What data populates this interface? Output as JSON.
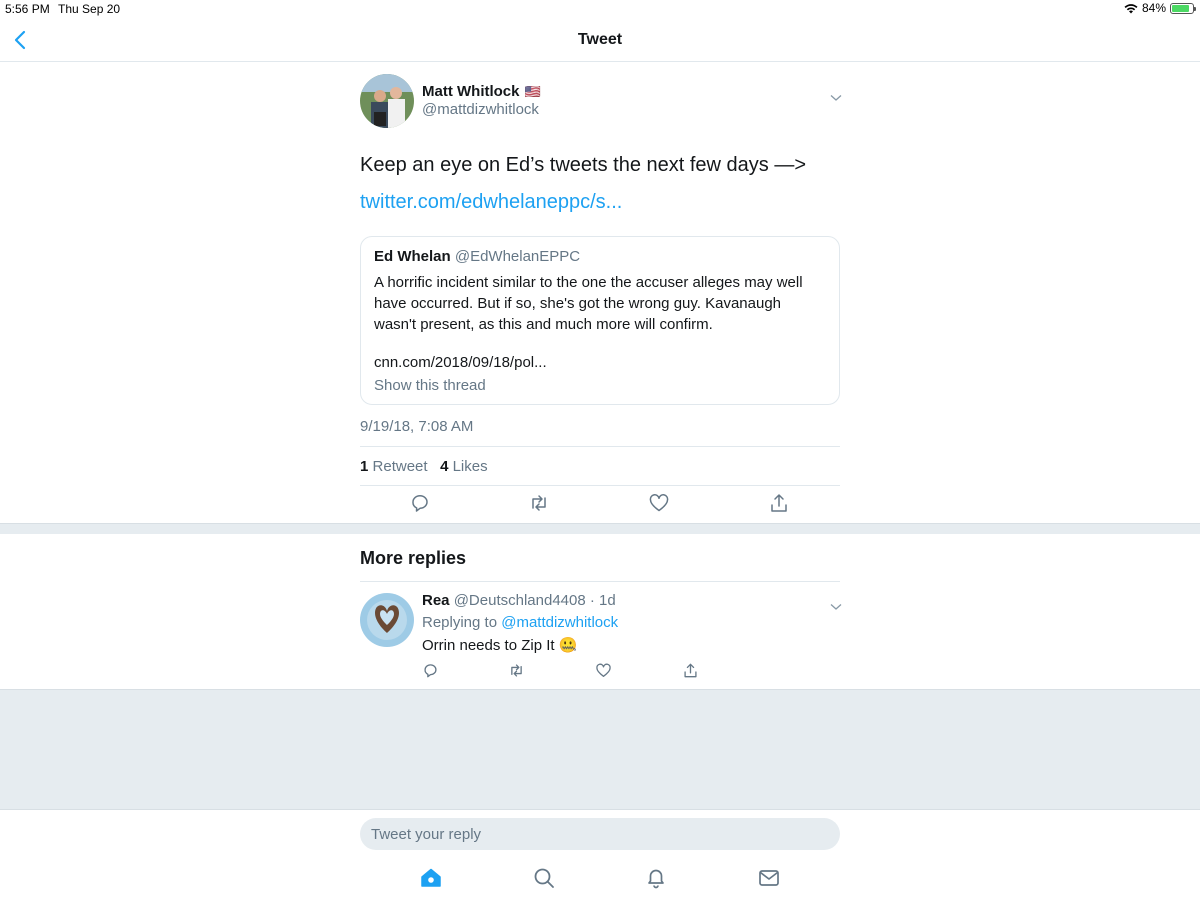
{
  "status_bar": {
    "time": "5:56 PM",
    "date": "Thu Sep 20",
    "battery": "84%",
    "battery_level": 0.84
  },
  "nav": {
    "title": "Tweet"
  },
  "tweet": {
    "author_name": "Matt Whitlock",
    "author_flag": "🇺🇸",
    "author_handle": "@mattdizwhitlock",
    "text": "Keep an eye on Ed’s tweets the next few days —>",
    "link": "twitter.com/edwhelaneppc/s...",
    "quote": {
      "name": "Ed Whelan",
      "handle": "@EdWhelanEPPC",
      "body": "A horrific incident similar to the one the accuser alleges may well have occurred. But if so, she's got the wrong guy. Kavanaugh wasn't present, as this and much more will confirm.",
      "url": "cnn.com/2018/09/18/pol...",
      "thread_label": "Show this thread"
    },
    "timestamp": "9/19/18, 7:08 AM",
    "retweet_count": "1",
    "retweet_label": "Retweet",
    "like_count": "4",
    "like_label": "Likes"
  },
  "more_replies": {
    "title": "More replies",
    "items": [
      {
        "name": "Rea",
        "handle": "@Deutschland4408",
        "separator": "·",
        "age": "1d",
        "replying_prefix": "Replying to",
        "replying_to": "@mattdizwhitlock",
        "text": "Orrin needs to Zip It 🤐"
      }
    ]
  },
  "composer": {
    "placeholder": "Tweet your reply"
  },
  "colors": {
    "accent": "#1da1f2",
    "muted": "#657786",
    "background_gray": "#e6ecf0"
  },
  "icons": [
    "back-chevron-icon",
    "reply-icon",
    "retweet-icon",
    "like-icon",
    "share-icon",
    "home-icon",
    "search-icon",
    "notifications-icon",
    "messages-icon"
  ]
}
